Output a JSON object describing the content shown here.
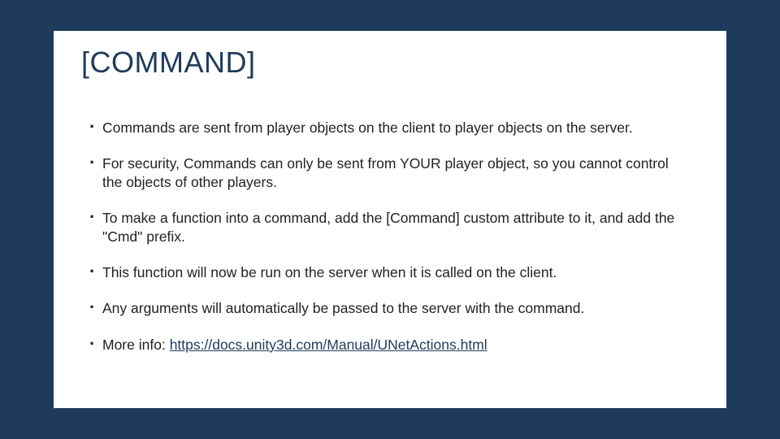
{
  "slide": {
    "title": "[COMMAND]",
    "bullets": [
      "Commands are sent from player objects on the client to player objects on the server.",
      "For security, Commands can only be sent from YOUR player object, so you cannot control the objects of other players.",
      "To make a function into a command, add the [Command] custom attribute to it, and add the \"Cmd\" prefix.",
      "This function will now be run on the server when it is called on the client.",
      "Any arguments will automatically be passed to the server with the command."
    ],
    "more_info_label": "More info: ",
    "more_info_link_text": "https://docs.unity3d.com/Manual/UNetActions.html"
  }
}
